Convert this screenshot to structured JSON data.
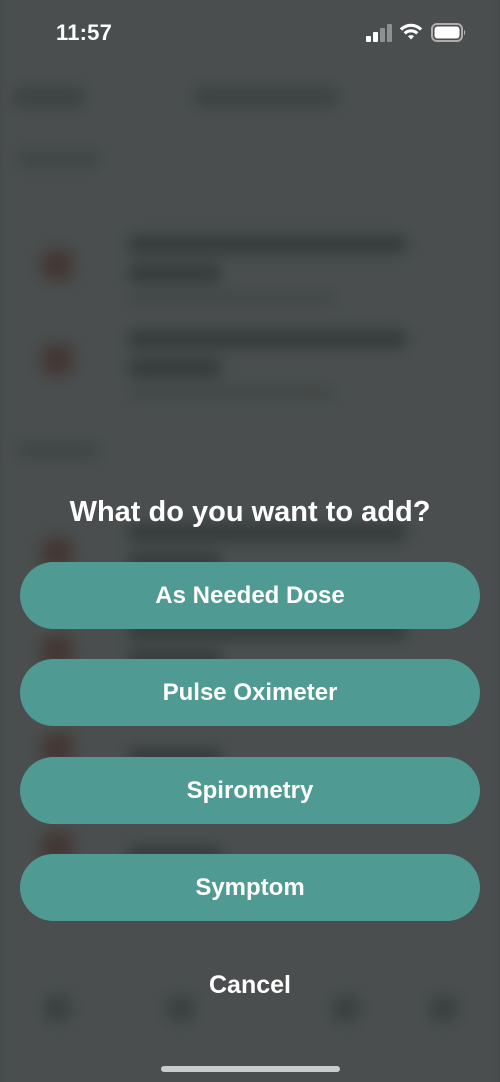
{
  "status_bar": {
    "time": "11:57",
    "signal_icon": "cellular-signal-icon",
    "wifi_icon": "wifi-icon",
    "battery_icon": "battery-icon"
  },
  "action_sheet": {
    "title": "What do you want to add?",
    "options": [
      {
        "label": "As Needed Dose"
      },
      {
        "label": "Pulse Oximeter"
      },
      {
        "label": "Spirometry"
      },
      {
        "label": "Symptom"
      }
    ],
    "cancel_label": "Cancel"
  },
  "colors": {
    "button_fill": "#4f9a92",
    "scrim": "#262b2a",
    "text": "#ffffff"
  }
}
